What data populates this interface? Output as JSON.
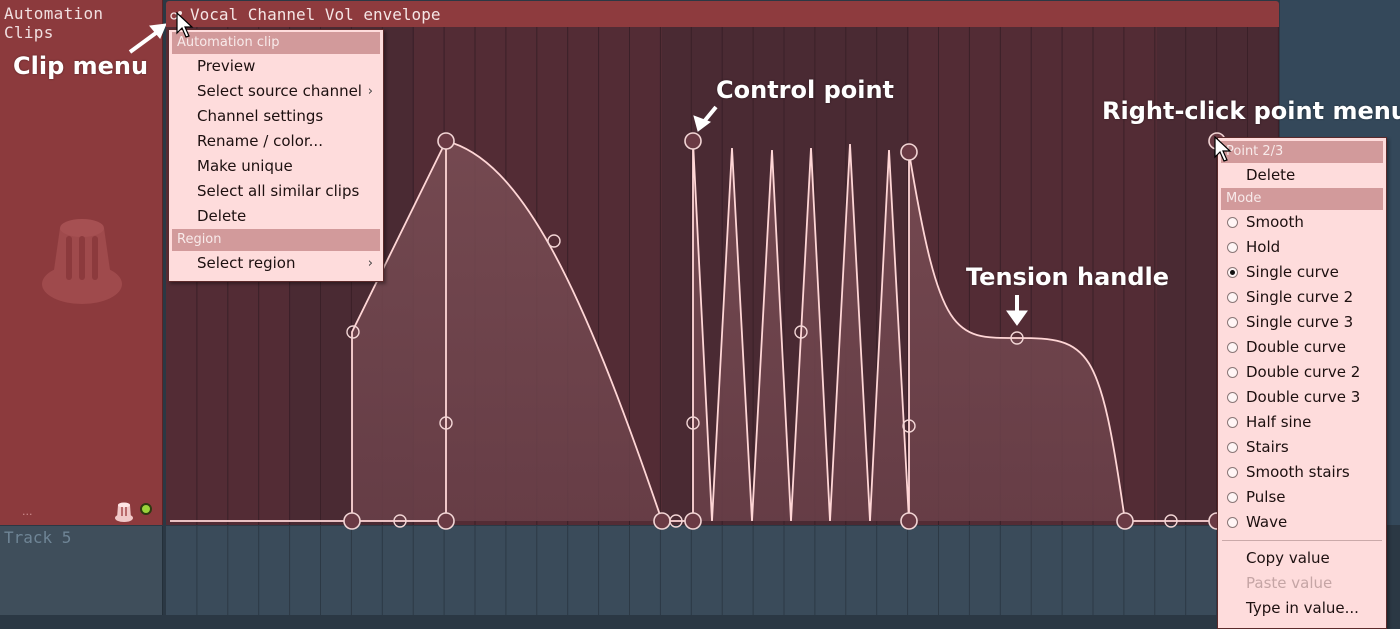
{
  "track_header": {
    "title": "Automation Clips",
    "dots": "..."
  },
  "track5": {
    "title": "Track 5"
  },
  "clip": {
    "title": "Vocal Channel Vol envelope"
  },
  "clip_menu": {
    "header": "Automation clip",
    "items": [
      {
        "label": "Preview",
        "submenu": false
      },
      {
        "label": "Select source channel",
        "submenu": true
      },
      {
        "label": "Channel settings",
        "submenu": false
      },
      {
        "label": "Rename / color...",
        "submenu": false
      },
      {
        "label": "Make unique",
        "submenu": false
      },
      {
        "label": "Select all similar clips",
        "submenu": false
      },
      {
        "label": "Delete",
        "submenu": false
      }
    ],
    "region_header": "Region",
    "region_items": [
      {
        "label": "Select region",
        "submenu": true
      }
    ]
  },
  "point_menu": {
    "header": "Point 2/3",
    "delete_label": "Delete",
    "mode_header": "Mode",
    "modes": [
      {
        "label": "Smooth",
        "selected": false
      },
      {
        "label": "Hold",
        "selected": false
      },
      {
        "label": "Single curve",
        "selected": true
      },
      {
        "label": "Single curve 2",
        "selected": false
      },
      {
        "label": "Single curve 3",
        "selected": false
      },
      {
        "label": "Double curve",
        "selected": false
      },
      {
        "label": "Double curve 2",
        "selected": false
      },
      {
        "label": "Double curve 3",
        "selected": false
      },
      {
        "label": "Half sine",
        "selected": false
      },
      {
        "label": "Stairs",
        "selected": false
      },
      {
        "label": "Smooth stairs",
        "selected": false
      },
      {
        "label": "Pulse",
        "selected": false
      },
      {
        "label": "Wave",
        "selected": false
      }
    ],
    "copy_value": "Copy value",
    "paste_value": "Paste value",
    "type_in_value": "Type in value..."
  },
  "callouts": {
    "clip_menu": "Clip menu",
    "control_point": "Control point",
    "tension_handle": "Tension handle",
    "right_click_menu": "Right-click point menu"
  },
  "colors": {
    "clip_title_bar": "#8e3b3e",
    "envelope_line": "#ffd6d6",
    "menu_background": "#fedcdc",
    "menu_header": "#d29a9b",
    "track_header": "#8c3a3d",
    "active_led": "#9ad43a"
  }
}
